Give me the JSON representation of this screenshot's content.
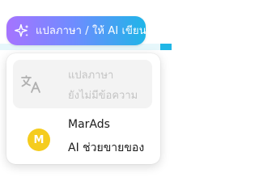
{
  "ai_button": {
    "label": "แปลภาษา / ให้ AI เขียน",
    "icon": "sparkle-icon",
    "gradient": [
      "#a574ff",
      "#6f8cff",
      "#1fb5e8"
    ]
  },
  "menu": {
    "items": [
      {
        "icon": "translate-icon",
        "title": "แปลภาษา",
        "subtitle": "ยังไม่มีข้อความ",
        "enabled": false
      },
      {
        "icon": "marads-logo",
        "logo_letter": "M",
        "title": "MarAds",
        "subtitle": "AI ช่วยขายของ",
        "enabled": true,
        "logo_color": "#f5cc1e"
      }
    ]
  }
}
